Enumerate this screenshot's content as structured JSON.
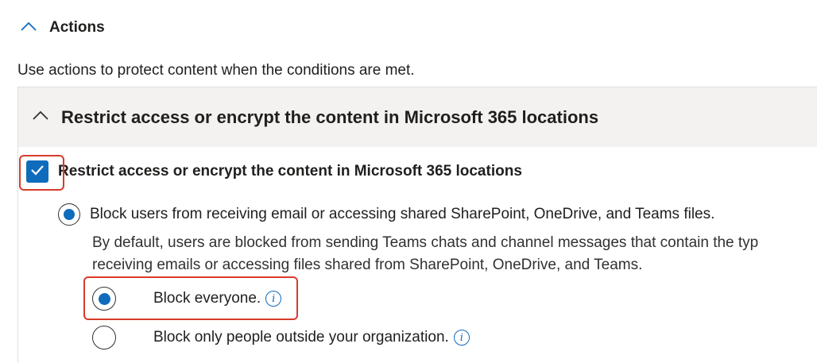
{
  "actions_section": {
    "title": "Actions",
    "expanded": true,
    "chevron_icon": "chevron-up-icon",
    "description": "Use actions to protect content when the conditions are met."
  },
  "restrict_panel": {
    "header_title": "Restrict access or encrypt the content in Microsoft 365 locations",
    "expanded": true,
    "chevron_icon": "chevron-up-icon",
    "checkbox": {
      "label": "Restrict access or encrypt the content in Microsoft 365 locations",
      "checked": true
    },
    "block_option": {
      "label": "Block users from receiving email or accessing shared SharePoint, OneDrive, and Teams files.",
      "selected": true,
      "help_line1": "By default, users are blocked from sending Teams chats and channel messages that contain the typ",
      "help_line2": "receiving emails or accessing files shared from SharePoint, OneDrive, and Teams."
    },
    "sub_options": [
      {
        "label": "Block everyone.",
        "selected": true,
        "info_icon": "info-icon"
      },
      {
        "label": "Block only people outside your organization.",
        "selected": false,
        "info_icon": "info-icon"
      }
    ]
  },
  "colors": {
    "accent": "#0f6cbd",
    "highlight": "#d83b2a",
    "panel_header_bg": "#f3f2f1",
    "text": "#201f1e"
  }
}
